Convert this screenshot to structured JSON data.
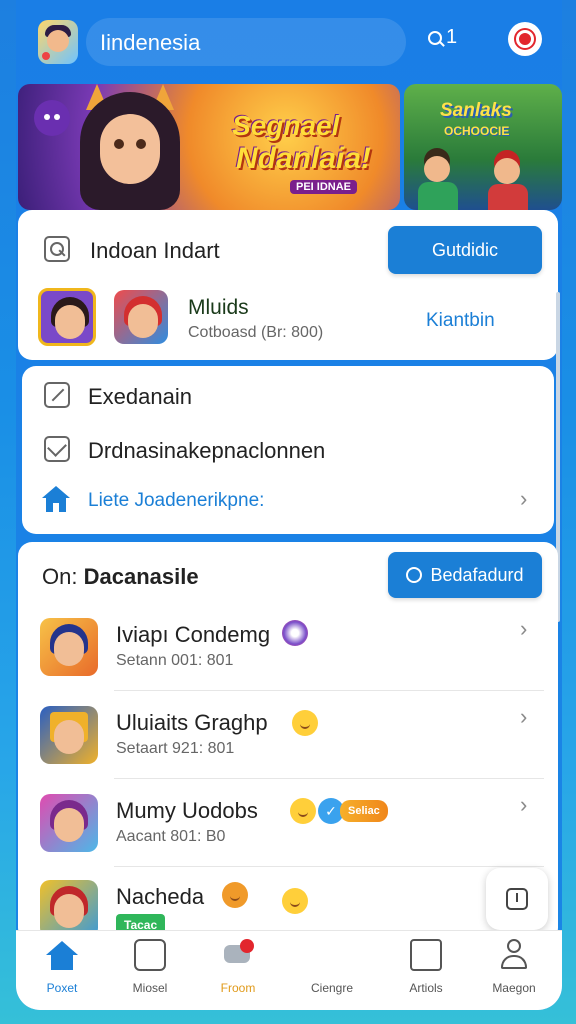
{
  "header": {
    "title": "Iindenesia",
    "search_label": "1"
  },
  "banners": {
    "main_line1": "Segnael",
    "main_line2": "Ndanlaia!",
    "main_line3": "PEI IDNAE",
    "side_line1": "Sanlaks",
    "side_line2": "OCHOOCIE"
  },
  "card1": {
    "title": "Indoan Indart",
    "button_label": "Gutdidic",
    "game_title": "Mluids",
    "game_sub": "Cotboasd (Br: 800)",
    "action_label": "Kiantbin"
  },
  "card2": {
    "item1": "Exedanain",
    "item2": "Drdnasinakepnaclonnen",
    "link": "Liete Joadenerikpne:"
  },
  "card3": {
    "heading_prefix": "On:",
    "heading_bold": "Dacanasile",
    "button_label": "Bedafadurd",
    "items": [
      {
        "title": "Iviapı Condemg",
        "sub": "Setann 001: 801"
      },
      {
        "title": "Uluiaits Graghp",
        "sub": "Setaart 921: 801"
      },
      {
        "title": "Mumy Uodobs",
        "sub": "Aacant 801: B0",
        "tag": "Seliac"
      },
      {
        "title": "Nacheda",
        "sub": "",
        "tag": "Tacac"
      }
    ]
  },
  "bottom_nav": [
    {
      "label": "Poxet",
      "active": true
    },
    {
      "label": "Miosel",
      "active": false
    },
    {
      "label": "Froom",
      "active": false
    },
    {
      "label": "Ciengre",
      "active": false
    },
    {
      "label": "Artiols",
      "active": false
    },
    {
      "label": "Maegon",
      "active": false
    }
  ],
  "colors": {
    "primary": "#1b7fd6",
    "background": "#1a86e6"
  }
}
